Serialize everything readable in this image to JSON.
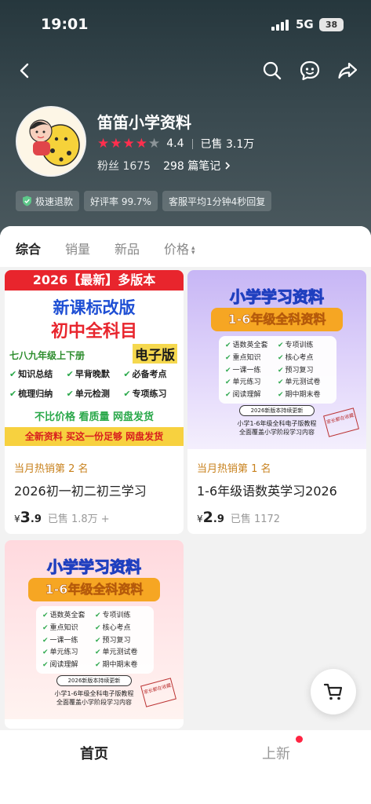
{
  "status_bar": {
    "time": "19:01",
    "network": "5G",
    "battery": "38"
  },
  "shop": {
    "name": "笛笛小学资料",
    "rating": "4.4",
    "rating_stars": 4,
    "sold": "已售 3.1万",
    "fans": "粉丝 1675",
    "notes": "298 篇笔记",
    "tags": [
      "极速退款",
      "好评率 99.7%",
      "客服平均1分钟4秒回复"
    ]
  },
  "sort_tabs": [
    "综合",
    "销量",
    "新品",
    "价格"
  ],
  "products": [
    {
      "rank": "当月热销第 2 名",
      "title": "2026初一初二初三学习",
      "price_symbol": "¥",
      "price_int": "3",
      "price_dec": ".9",
      "sold": "已售 1.8万 +",
      "poster": {
        "top": "2026【最新】多版本",
        "line1": "新课标改版",
        "line2": "初中全科目",
        "sub": "七八九年级上下册",
        "edition": "电子版",
        "features": [
          "知识总结",
          "早背晚默",
          "必备考点",
          "梳理归纳",
          "单元检测",
          "专项练习"
        ],
        "slogan": "不比价格  看质量  网盘发货",
        "bottom": "全新资料 买这一份足够 网盘发货"
      }
    },
    {
      "rank": "当月热销第 1 名",
      "title": "1-6年级语数英学习2026",
      "price_symbol": "¥",
      "price_int": "2",
      "price_dec": ".9",
      "sold": "已售 1172",
      "poster": {
        "h1": "小学学习资料",
        "h2": "1-6年级全科资料",
        "items": [
          "语数英全套",
          "专项训练",
          "重点知识",
          "核心考点",
          "一课一练",
          "预习复习",
          "单元练习",
          "单元测试卷",
          "阅读理解",
          "期中期末卷"
        ],
        "pill": "2026新版本持续更新",
        "foot1": "小学1-6年级全科电子版教程",
        "foot2": "全面覆盖小学阶段学习内容",
        "seal": "家长都在收藏"
      }
    },
    {
      "poster": {
        "h1": "小学学习资料",
        "h2": "1-6年级全科资料",
        "items": [
          "语数英全套",
          "专项训练",
          "重点知识",
          "核心考点",
          "一课一练",
          "预习复习",
          "单元练习",
          "单元测试卷",
          "阅读理解",
          "期中期末卷"
        ],
        "pill": "2026新版本持续更新",
        "foot1": "小学1-6年级全科电子版教程",
        "foot2": "全面覆盖小学阶段学习内容",
        "seal": "家长都在收藏"
      }
    }
  ],
  "tab_bar": {
    "home": "首页",
    "new": "上新"
  },
  "colors": {
    "accent": "#ff2442",
    "rank": "#c8821e",
    "header": "#2f4045"
  },
  "icons": [
    "back-icon",
    "search-icon",
    "chat-icon",
    "share-icon",
    "shield-icon",
    "chevron-right-icon",
    "cart-icon"
  ]
}
